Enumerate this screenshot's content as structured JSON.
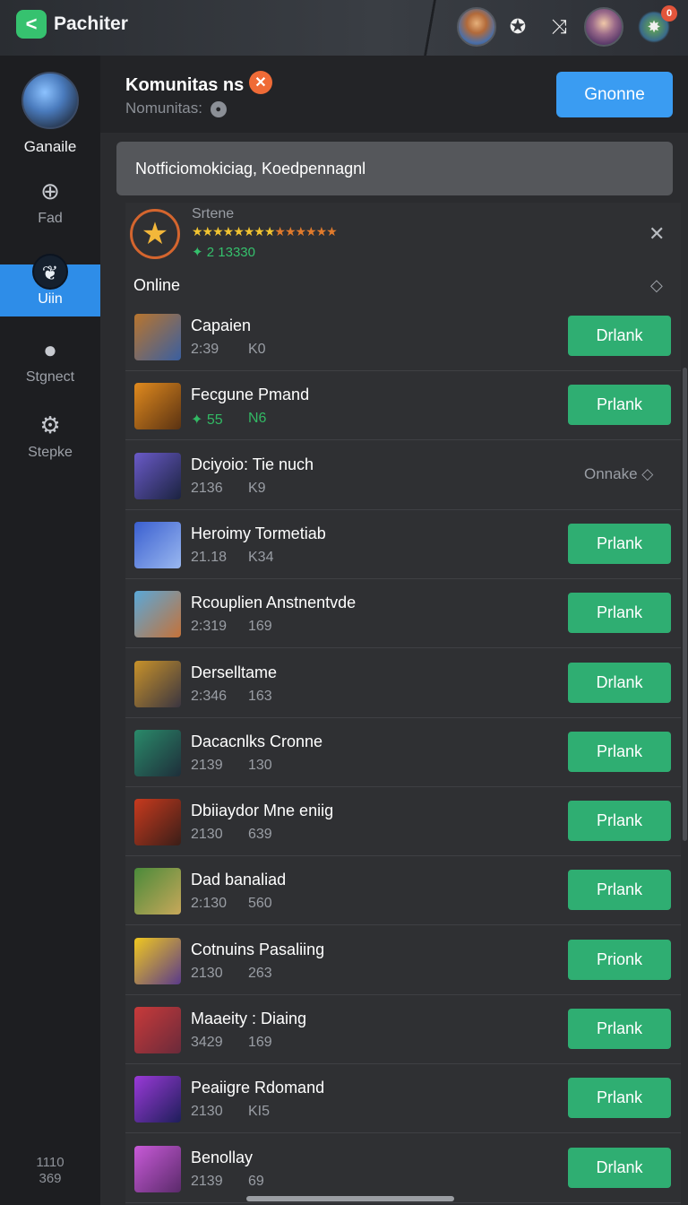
{
  "app": {
    "logo_glyph": "<",
    "title": "Pachiter"
  },
  "topbar": {
    "icons": [
      "avatar-knight",
      "settings-cog",
      "shuffle",
      "avatar-girl",
      "avatar-creature"
    ],
    "notification_badge": "0"
  },
  "sidebar": {
    "profile_label": "Ganaile",
    "items": [
      {
        "label": "Fad",
        "icon": "chat-bubble-icon",
        "glyph": "⊕"
      },
      {
        "label": "Uiin",
        "icon": "leaf-icon",
        "glyph": "❦",
        "active": true
      },
      {
        "label": "Stgnect",
        "icon": "person-icon",
        "glyph": "●"
      },
      {
        "label": "Stepke",
        "icon": "gear-icon",
        "glyph": "⚙"
      }
    ],
    "footer_line1": "1110",
    "footer_line2": "369"
  },
  "panel": {
    "title": "Komunitas ns",
    "subtitle": "Nomunitas:",
    "primary_button": "Gnonne",
    "notification": "Notficiomokiciag, Koedpennagnl"
  },
  "profile": {
    "name": "Srtene",
    "stars_gold": "★★★★★★★★",
    "stars_orange": "★★★★★★",
    "count": "2 13330"
  },
  "section": {
    "label": "Online"
  },
  "rows": [
    {
      "title": "Capaien",
      "a": "2:39",
      "b": "K0",
      "action": "Drlank",
      "thumb": [
        "#b8752e",
        "#3a5fa0"
      ]
    },
    {
      "title": "Fecgune Pmand",
      "a": "✦ 55",
      "b": "N6",
      "green": true,
      "action": "Prlank",
      "thumb": [
        "#e08a1e",
        "#5a3212"
      ]
    },
    {
      "title": "Dciyoio: Tie nuch",
      "a": "2136",
      "b": "K9",
      "status": "Onnake ◇",
      "thumb": [
        "#6a5ac8",
        "#1b2340"
      ]
    },
    {
      "title": "Heroimy Tormetiab",
      "a": "21.18",
      "b": "K34",
      "action": "Prlank",
      "thumb": [
        "#3a5fd0",
        "#9ab8f0"
      ]
    },
    {
      "title": "Rcouplien Anstnentvde",
      "a": "2:319",
      "b": "169",
      "action": "Prlank",
      "thumb": [
        "#5aa8d8",
        "#c4723a"
      ]
    },
    {
      "title": "Derselltame",
      "a": "2:346",
      "b": "163",
      "action": "Drlank",
      "thumb": [
        "#c8922a",
        "#3a3540"
      ]
    },
    {
      "title": "Dacacnlks Cronne",
      "a": "2139",
      "b": "130",
      "action": "Prlank",
      "thumb": [
        "#2a8a6a",
        "#1e2e3a"
      ]
    },
    {
      "title": "Dbiiaydor Mne eniig",
      "a": "2130",
      "b": "639",
      "action": "Prlank",
      "thumb": [
        "#c83a1e",
        "#3a1e18"
      ]
    },
    {
      "title": "Dad banaliad",
      "a": "2:130",
      "b": "560",
      "action": "Prlank",
      "thumb": [
        "#4a8a3a",
        "#c8a85a"
      ]
    },
    {
      "title": "Cotnuins Pasaliing",
      "a": "2130",
      "b": "263",
      "action": "Prionk",
      "thumb": [
        "#f0c820",
        "#5a3a8a"
      ]
    },
    {
      "title": "Maaeity : Diaing",
      "a": "3429",
      "b": "169",
      "action": "Prlank",
      "thumb": [
        "#c83a3a",
        "#6a2a3a"
      ]
    },
    {
      "title": "Peaiigre Rdomand",
      "a": "2130",
      "b": "KI5",
      "action": "Prlank",
      "thumb": [
        "#9a3ad8",
        "#1e1e5a"
      ]
    },
    {
      "title": "Benollay",
      "a": "2139",
      "b": "69",
      "action": "Drlank",
      "thumb": [
        "#c85ad8",
        "#5a2a6a"
      ]
    }
  ]
}
